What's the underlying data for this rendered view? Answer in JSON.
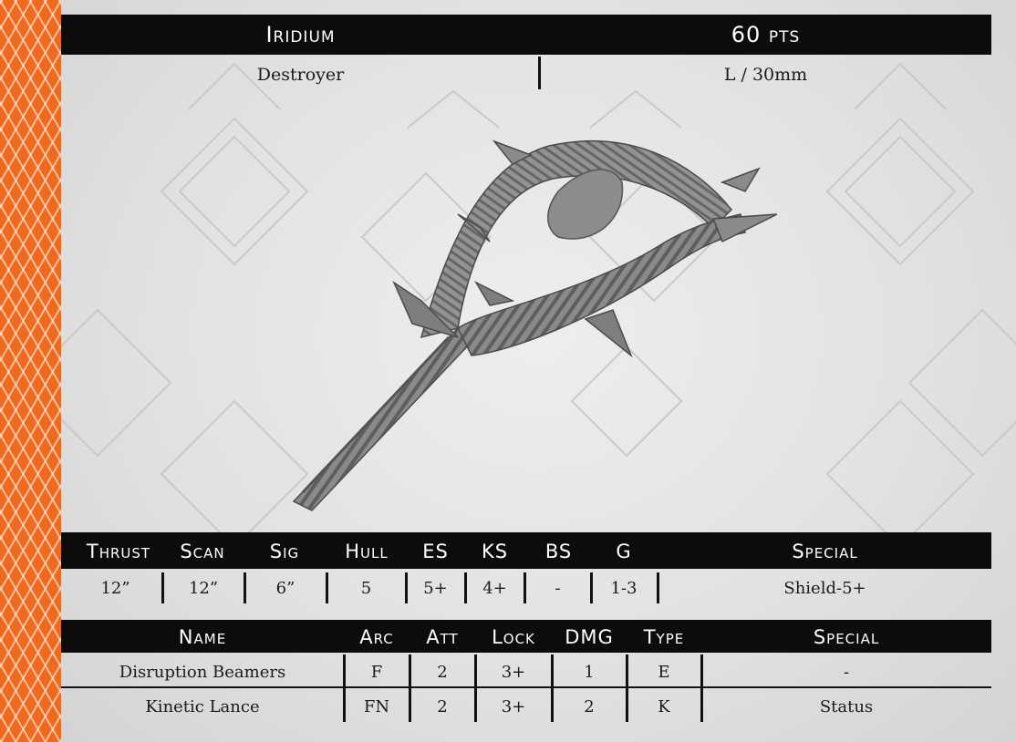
{
  "ship": {
    "name": "Iridium",
    "points": "60 pts",
    "class": "Destroyer",
    "base": "L / 30mm"
  },
  "stats": {
    "headers": [
      "Thrust",
      "Scan",
      "Sig",
      "Hull",
      "ES",
      "KS",
      "BS",
      "G",
      "Special"
    ],
    "values": [
      "12”",
      "12”",
      "6”",
      "5",
      "5+",
      "4+",
      "-",
      "1-3",
      "Shield-5+"
    ]
  },
  "weapons": {
    "headers": [
      "Name",
      "Arc",
      "Att",
      "Lock",
      "DMG",
      "Type",
      "Special"
    ],
    "rows": [
      [
        "Disruption Beamers",
        "F",
        "2",
        "3+",
        "1",
        "E",
        "-"
      ],
      [
        "Kinetic Lance",
        "FN",
        "2",
        "3+",
        "2",
        "K",
        "Status"
      ]
    ]
  },
  "colors": {
    "accent_stripe": "#ee6a1e",
    "header_bg": "#0c0c0c",
    "card_bg": "#e2e2e2"
  },
  "icons": {
    "model_image": "ship-miniature-illustration"
  }
}
